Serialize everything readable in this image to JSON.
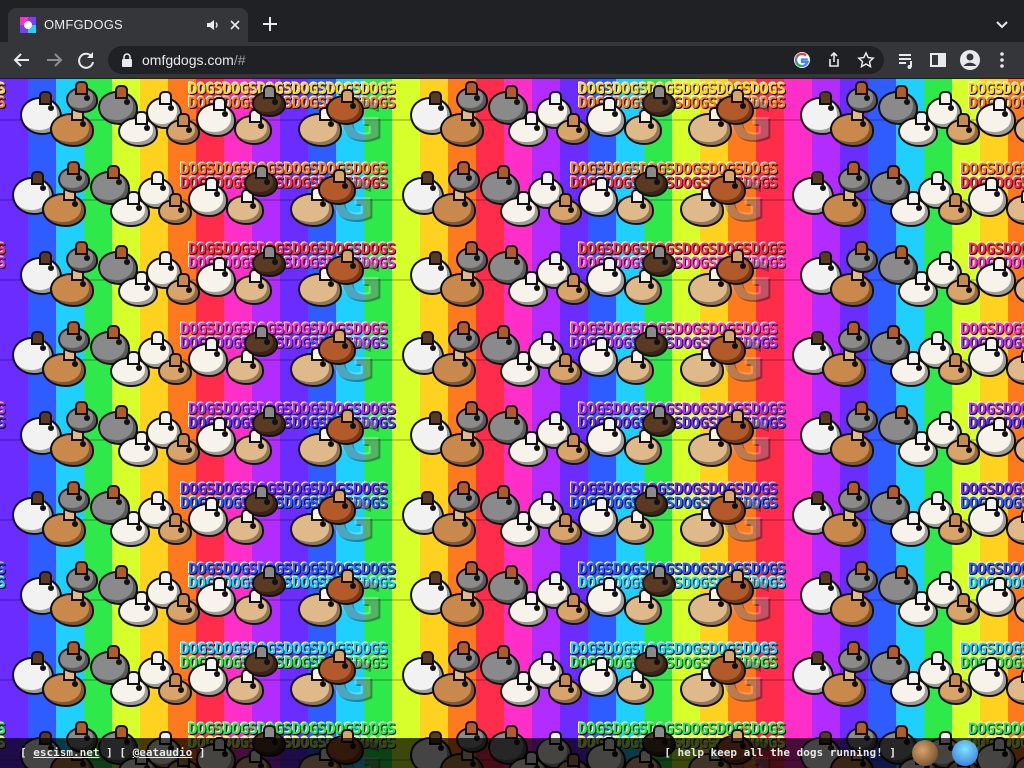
{
  "browser": {
    "tab": {
      "title": "OMFGDOGS",
      "audio_icon": "speaker-icon",
      "close_icon": "close-icon"
    },
    "new_tab_icon": "plus-icon",
    "tab_menu_icon": "chevron-down-icon",
    "toolbar": {
      "back_icon": "arrow-left-icon",
      "forward_icon": "arrow-right-icon",
      "reload_icon": "reload-icon",
      "url_host": "omfgdogs.com",
      "url_rest": "/#",
      "icons": [
        "google-icon",
        "share-icon",
        "star-icon",
        "media-queue-icon",
        "side-panel-icon",
        "profile-icon",
        "kebab-menu-icon"
      ]
    }
  },
  "page": {
    "tile_text": "DOGSDOGSDOGSDOGSDOGSDOGS",
    "big_letter": "G",
    "colors": {
      "rainbow": [
        "#6a2cff",
        "#2f5cff",
        "#1fd0ff",
        "#2fe84a",
        "#d6ff2c",
        "#ffd21f",
        "#ff7a1f",
        "#ff2d4b",
        "#ff2fc8",
        "#b22cff"
      ],
      "dog_colors": [
        "#f2f2f2",
        "#c9894d",
        "#8a8a8a",
        "#f7f3ea",
        "#d9a46a",
        "#5a3a22",
        "#e0b98a",
        "#b35a2a"
      ]
    }
  },
  "footer": {
    "left_open": "[ ",
    "link1": "escism.net",
    "mid": " ] [ ",
    "link2": "@eataudio",
    "left_close": " ]",
    "right": "[ help keep all the dogs running! ]",
    "icons": [
      "dog-icon",
      "mermaid-icon"
    ]
  }
}
